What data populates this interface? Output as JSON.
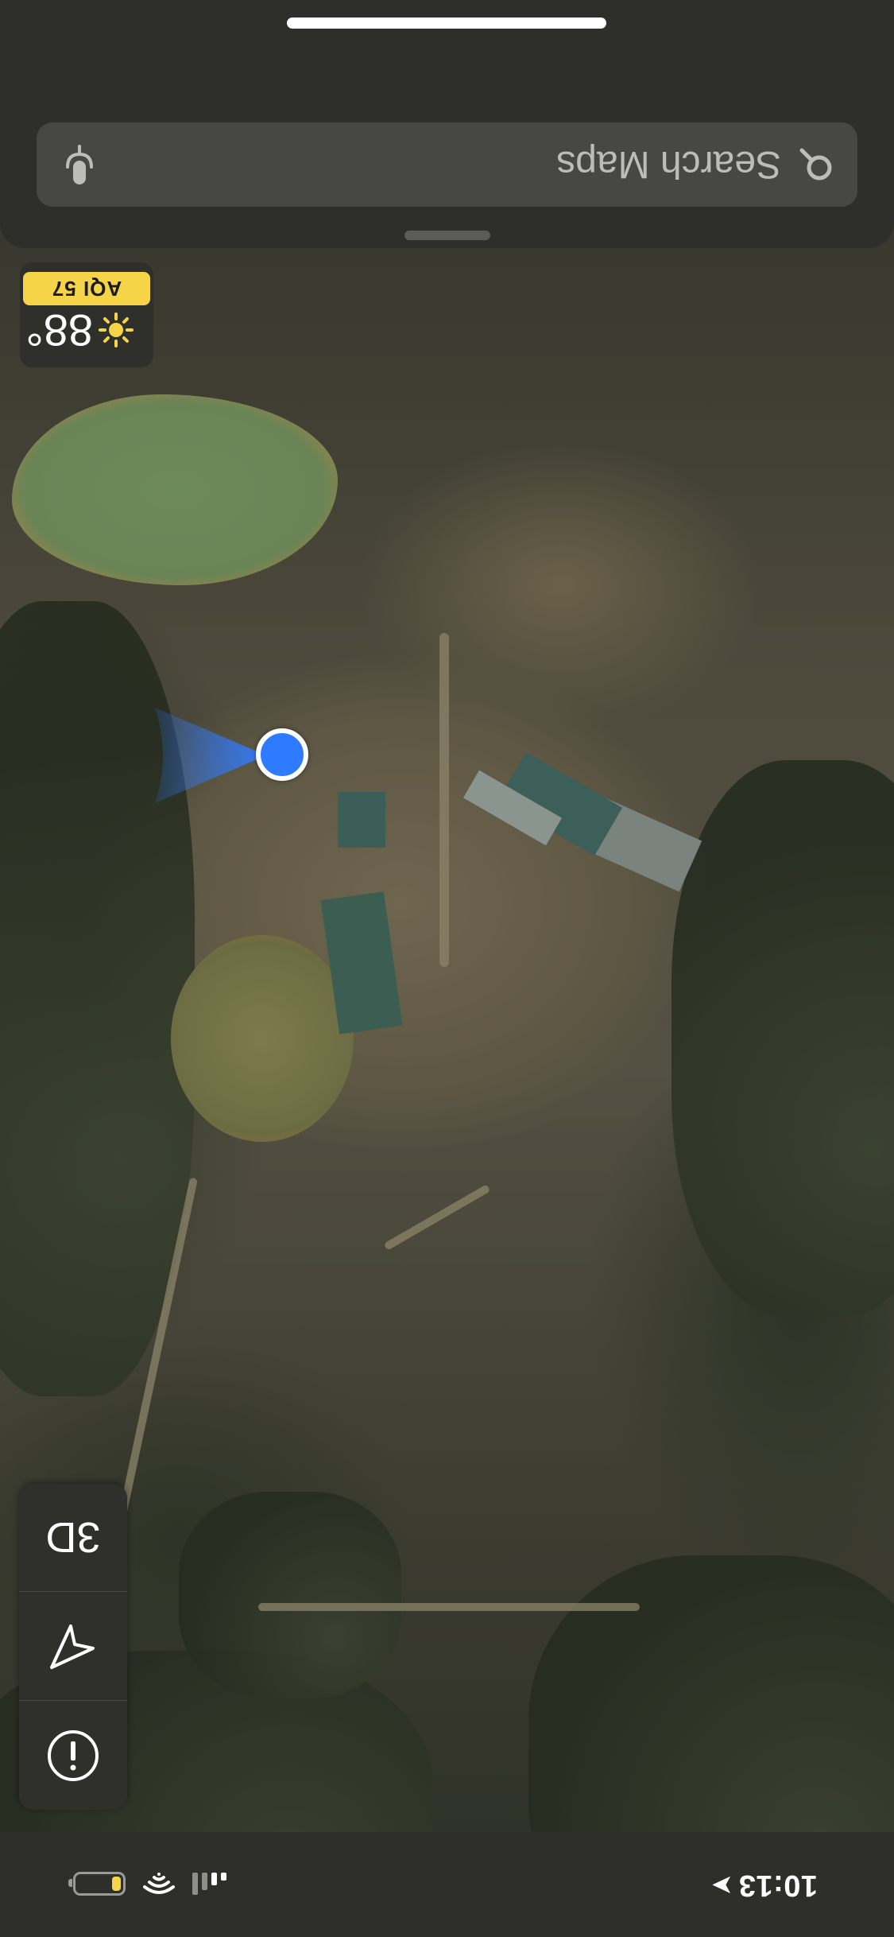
{
  "status_bar": {
    "time": "10:13",
    "location_arrow": "➤",
    "battery_level": 0.2
  },
  "map_controls": {
    "info_icon": "info-icon",
    "tracking_icon": "location-arrow-icon",
    "view_3d_label": "3D"
  },
  "weather": {
    "icon": "sun-icon",
    "temperature": "88°",
    "aqi_label": "AQI 57"
  },
  "search": {
    "placeholder": "Search Maps",
    "search_icon": "search-icon",
    "mic_icon": "microphone-icon"
  },
  "map": {
    "style": "satellite",
    "user_location_color": "#2f7bff",
    "aqi_color": "#f5d547"
  }
}
